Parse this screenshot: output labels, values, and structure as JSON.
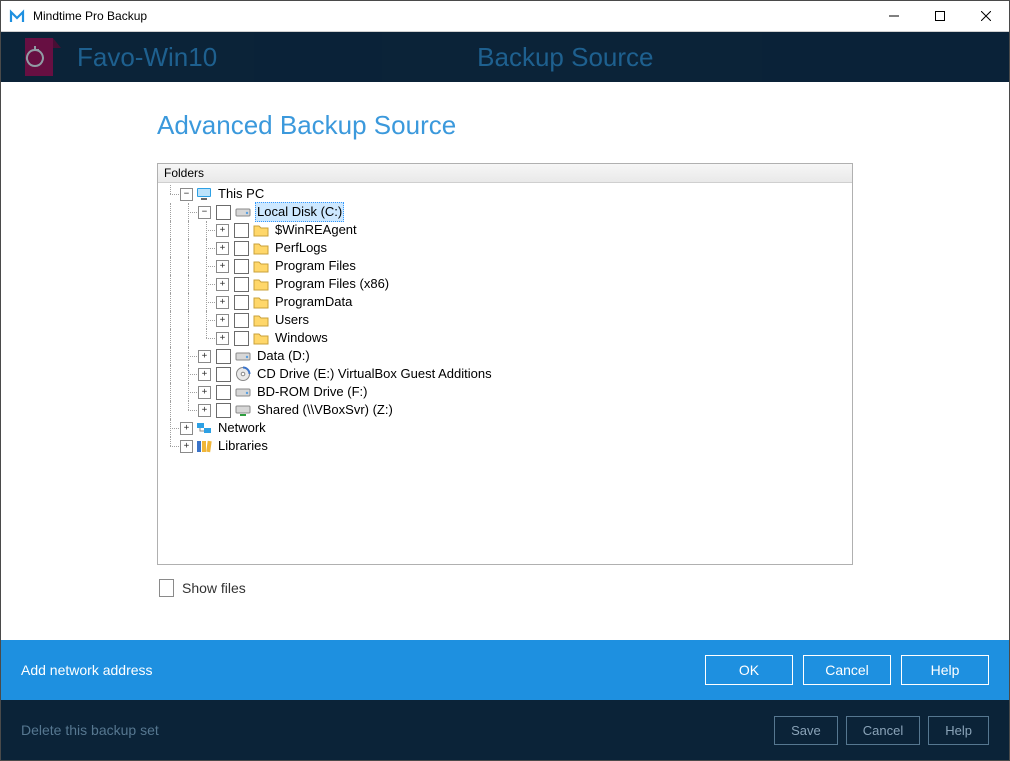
{
  "window_title": "Mindtime Pro Backup",
  "backdrop": {
    "set_name": "Favo-Win10",
    "section": "Backup Source",
    "delete_label": "Delete this backup set",
    "save_label": "Save",
    "cancel_label": "Cancel",
    "help_label": "Help"
  },
  "modal": {
    "title": "Advanced Backup Source",
    "panel_header": "Folders",
    "show_files_label": "Show files",
    "footer_link": "Add network address",
    "ok_label": "OK",
    "cancel_label": "Cancel",
    "help_label": "Help"
  },
  "tree": {
    "root": "This PC",
    "c_drive": "Local Disk (C:)",
    "c_children": [
      "$WinREAgent",
      "PerfLogs",
      "Program Files",
      "Program Files (x86)",
      "ProgramData",
      "Users",
      "Windows"
    ],
    "d_drive": "Data (D:)",
    "e_drive": "CD Drive (E:) VirtualBox Guest Additions",
    "f_drive": "BD-ROM Drive (F:)",
    "z_drive": "Shared (\\\\VBoxSvr) (Z:)",
    "network": "Network",
    "libraries": "Libraries"
  }
}
